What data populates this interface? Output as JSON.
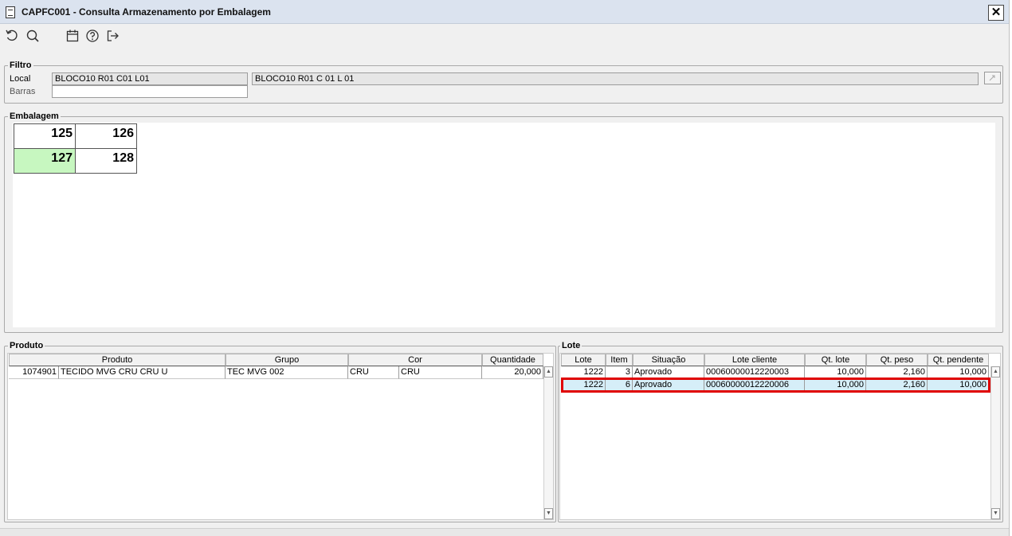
{
  "window": {
    "title": "CAPFC001 - Consulta Armazenamento por Embalagem",
    "close_label": "✕"
  },
  "toolbar": {
    "icons": [
      "refresh-icon",
      "search-icon",
      "calendar-icon",
      "help-icon",
      "exit-icon"
    ]
  },
  "filtro": {
    "title": "Filtro",
    "local_label": "Local",
    "local_code": "BLOCO10 R01 C01 L01",
    "local_desc": "BLOCO10 R01 C 01 L 01",
    "barras_label": "Barras",
    "barras_value": ""
  },
  "embalagem": {
    "title": "Embalagem",
    "cells": [
      "125",
      "126",
      "127",
      "128"
    ],
    "selected": "127",
    "selected_color": "#c7f7c0"
  },
  "produto": {
    "title": "Produto",
    "columns": [
      "Produto",
      "Grupo",
      "Cor",
      "Quantidade"
    ],
    "rows": [
      {
        "codigo": "1074901",
        "produto": "TECIDO MVG CRU CRU U",
        "grupo": "TEC MVG 002",
        "cor_cod": "CRU",
        "cor": "CRU",
        "quantidade": "20,000"
      }
    ]
  },
  "lote": {
    "title": "Lote",
    "columns": [
      "Lote",
      "Item",
      "Situação",
      "Lote cliente",
      "Qt. lote",
      "Qt. peso",
      "Qt. pendente"
    ],
    "rows": [
      {
        "lote": "1222",
        "item": "3",
        "situacao": "Aprovado",
        "lote_cliente": "00060000012220003",
        "qt_lote": "10,000",
        "qt_peso": "2,160",
        "qt_pendente": "10,000"
      },
      {
        "lote": "1222",
        "item": "6",
        "situacao": "Aprovado",
        "lote_cliente": "00060000012220006",
        "qt_lote": "10,000",
        "qt_peso": "2,160",
        "qt_pendente": "10,000"
      }
    ],
    "highlight_color": "#e00000"
  }
}
